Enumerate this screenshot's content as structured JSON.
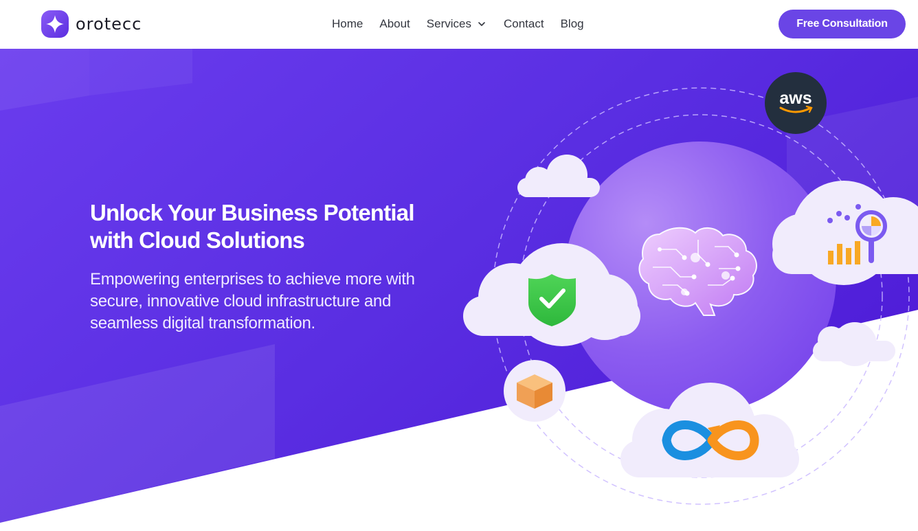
{
  "brand": {
    "name": "orotecc",
    "colors": {
      "primary": "#6a45e6",
      "hero": "#5f32e3",
      "text_dark": "#33363f"
    }
  },
  "nav": {
    "items": [
      {
        "label": "Home"
      },
      {
        "label": "About"
      },
      {
        "label": "Services",
        "has_dropdown": true,
        "icon": "chevron-down-icon"
      },
      {
        "label": "Contact"
      },
      {
        "label": "Blog"
      }
    ],
    "cta_label": "Free Consultation"
  },
  "hero": {
    "title_line1": "Unlock Your Business Potential",
    "title_line2": "with Cloud Solutions",
    "subtitle_line1": "Empowering enterprises to achieve more with",
    "subtitle_line2": "secure, innovative cloud infrastructure and",
    "subtitle_line3": "seamless digital transformation.",
    "illustration": {
      "aws_badge_text": "aws",
      "icons": [
        "cloud-icon",
        "shield-check-icon",
        "ai-brain-icon",
        "analytics-chart-icon",
        "package-box-icon",
        "infinity-devops-icon",
        "aws-logo-icon"
      ]
    }
  }
}
